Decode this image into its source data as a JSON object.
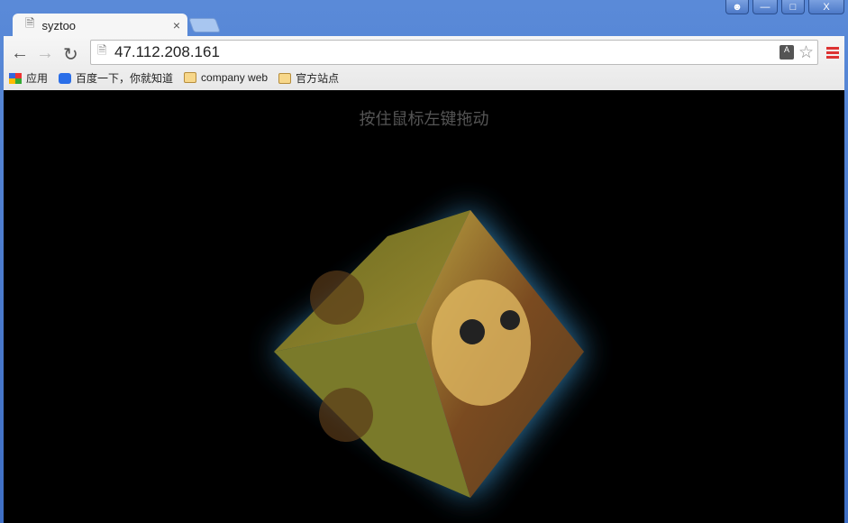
{
  "window": {
    "controls": [
      "user",
      "minimize",
      "maximize",
      "close"
    ]
  },
  "tab": {
    "title": "syztoo",
    "close": "×"
  },
  "address": {
    "url": "47.112.208.161"
  },
  "bookmarks": [
    {
      "label": "应用",
      "icon": "apps-icon"
    },
    {
      "label": "百度一下，你就知道",
      "icon": "baidu-icon"
    },
    {
      "label": "company web",
      "icon": "folder-icon"
    },
    {
      "label": "官方站点",
      "icon": "folder-icon"
    }
  ],
  "page": {
    "hint": "按住鼠标左键拖动"
  },
  "colors": {
    "glow": "#3fa7e8",
    "cube": "#8a8a2a",
    "menu": "#d33"
  }
}
